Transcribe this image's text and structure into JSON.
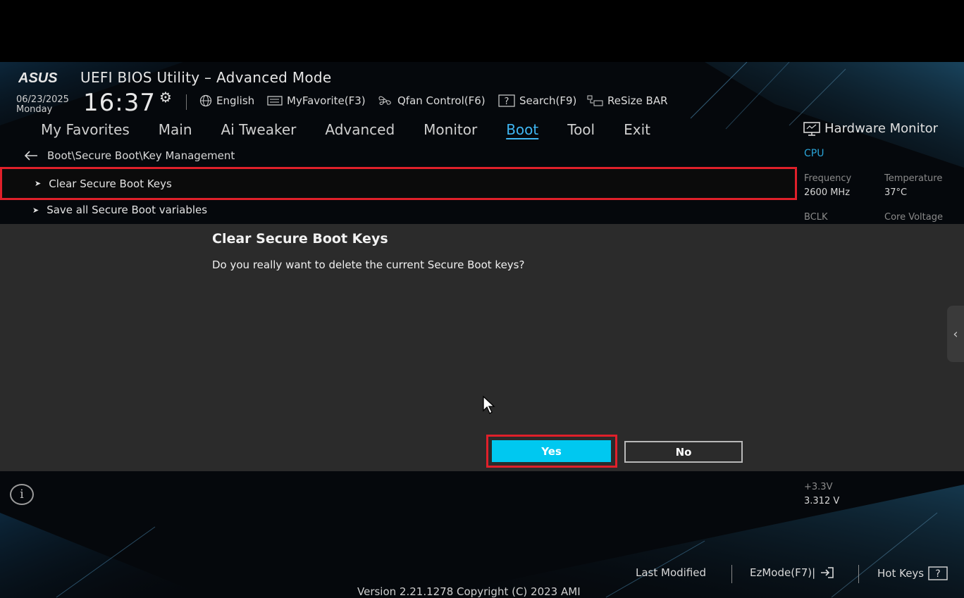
{
  "header": {
    "brand": "ASUS",
    "title": "UEFI BIOS Utility – Advanced Mode",
    "date": "06/23/2025",
    "weekday": "Monday",
    "time": "16:37"
  },
  "toolbar": {
    "language": "English",
    "myfavorite": "MyFavorite(F3)",
    "qfan": "Qfan Control(F6)",
    "search": "Search(F9)",
    "resizebar": "ReSize BAR"
  },
  "tabs": [
    {
      "label": "My Favorites"
    },
    {
      "label": "Main"
    },
    {
      "label": "Ai Tweaker"
    },
    {
      "label": "Advanced"
    },
    {
      "label": "Monitor"
    },
    {
      "label": "Boot",
      "active": true
    },
    {
      "label": "Tool"
    },
    {
      "label": "Exit"
    }
  ],
  "breadcrumb": "Boot\\Secure Boot\\Key Management",
  "menu": {
    "items": [
      {
        "label": "Clear Secure Boot Keys",
        "selected": true
      },
      {
        "label": "Save all Secure Boot variables"
      }
    ]
  },
  "hardware_monitor": {
    "title": "Hardware Monitor",
    "section": "CPU",
    "frequency_label": "Frequency",
    "frequency_value": "2600 MHz",
    "temperature_label": "Temperature",
    "temperature_value": "37°C",
    "bclk_label": "BCLK",
    "core_voltage_label": "Core Voltage",
    "v33_label": "+3.3V",
    "v33_value": "3.312 V"
  },
  "dialog": {
    "title": "Clear Secure Boot Keys",
    "message": "Do you really want to delete the current Secure Boot keys?",
    "yes_label": "Yes",
    "no_label": "No"
  },
  "footer": {
    "last_modified": "Last Modified",
    "ezmode": "EzMode(F7)|",
    "hotkeys": "Hot Keys",
    "version": "Version 2.21.1278 Copyright (C) 2023 AMI"
  },
  "colors": {
    "accent": "#00c8f0",
    "highlight": "#e0202a",
    "active_tab": "#3fb6f2"
  }
}
